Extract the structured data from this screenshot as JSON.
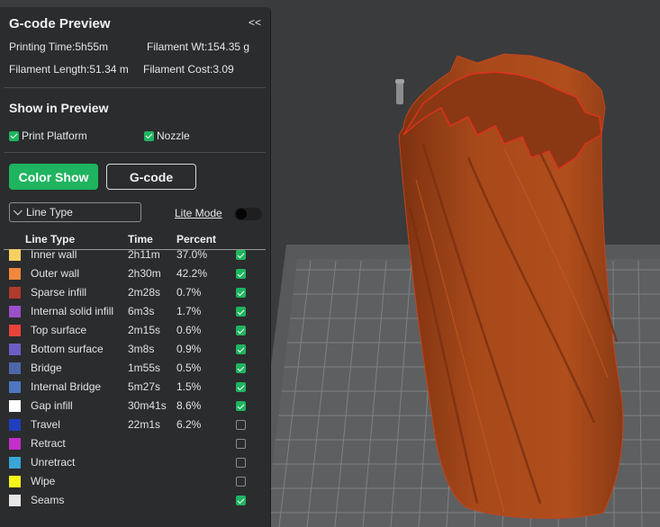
{
  "panel": {
    "title": "G-code Preview",
    "collapse_label": "<<",
    "printing_time": "Printing Time:5h55m",
    "filament_weight": "Filament Wt:154.35 g",
    "filament_length": "Filament Length:51.34 m",
    "filament_cost": "Filament Cost:3.09"
  },
  "show_in_preview": {
    "title": "Show in Preview",
    "print_platform": {
      "label": "Print Platform",
      "checked": true
    },
    "nozzle": {
      "label": "Nozzle",
      "checked": true
    }
  },
  "buttons": {
    "color_show": "Color Show",
    "gcode": "G-code"
  },
  "view_mode": {
    "selected": "Line Type",
    "lite_mode_label": "Lite Mode",
    "lite_mode_on": false
  },
  "table": {
    "headers": {
      "line_type": "Line Type",
      "time": "Time",
      "percent": "Percent"
    },
    "rows": [
      {
        "name": "Inner wall",
        "time": "2h11m",
        "percent": "37.0%",
        "color": "#f5d061",
        "checked": true
      },
      {
        "name": "Outer wall",
        "time": "2h30m",
        "percent": "42.2%",
        "color": "#f0873c",
        "checked": true
      },
      {
        "name": "Sparse infill",
        "time": "2m28s",
        "percent": "0.7%",
        "color": "#b03a2e",
        "checked": true
      },
      {
        "name": "Internal solid infill",
        "time": "6m3s",
        "percent": "1.7%",
        "color": "#9b4fc9",
        "checked": true
      },
      {
        "name": "Top surface",
        "time": "2m15s",
        "percent": "0.6%",
        "color": "#e8423b",
        "checked": true
      },
      {
        "name": "Bottom surface",
        "time": "3m8s",
        "percent": "0.9%",
        "color": "#6b5fc6",
        "checked": true
      },
      {
        "name": "Bridge",
        "time": "1m55s",
        "percent": "0.5%",
        "color": "#4e67a8",
        "checked": true
      },
      {
        "name": "Internal Bridge",
        "time": "5m27s",
        "percent": "1.5%",
        "color": "#4d77c0",
        "checked": true
      },
      {
        "name": "Gap infill",
        "time": "30m41s",
        "percent": "8.6%",
        "color": "#ffffff",
        "checked": true
      },
      {
        "name": "Travel",
        "time": "22m1s",
        "percent": "6.2%",
        "color": "#1f3fbf",
        "checked": false
      },
      {
        "name": "Retract",
        "time": "",
        "percent": "",
        "color": "#c22fc9",
        "checked": false
      },
      {
        "name": "Unretract",
        "time": "",
        "percent": "",
        "color": "#3aa6d6",
        "checked": false
      },
      {
        "name": "Wipe",
        "time": "",
        "percent": "",
        "color": "#f5f51a",
        "checked": false
      },
      {
        "name": "Seams",
        "time": "",
        "percent": "",
        "color": "#e6e6e6",
        "checked": true
      }
    ]
  },
  "viewport": {
    "model_color": "#a8491a",
    "seam_color": "#e0301e",
    "plate_color": "#5e5f61"
  }
}
